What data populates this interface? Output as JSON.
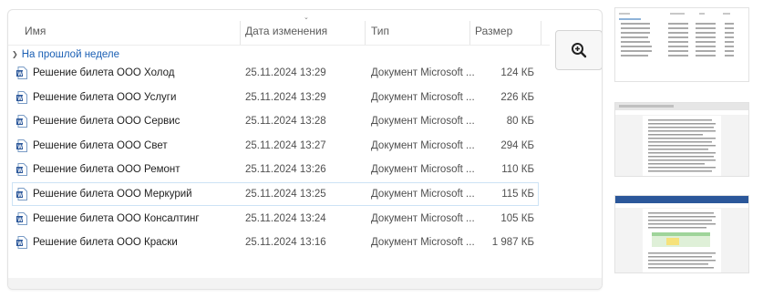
{
  "columns": {
    "name": "Имя",
    "date": "Дата изменения",
    "type": "Тип",
    "size": "Размер"
  },
  "group": {
    "label": "На прошлой неделе"
  },
  "files": [
    {
      "name": "Решение билета ООО Холод",
      "date": "25.11.2024 13:29",
      "type": "Документ Microsoft ...",
      "size": "124 КБ"
    },
    {
      "name": "Решение билета ООО Услуги",
      "date": "25.11.2024 13:29",
      "type": "Документ Microsoft ...",
      "size": "226 КБ"
    },
    {
      "name": "Решение билета ООО Сервис",
      "date": "25.11.2024 13:28",
      "type": "Документ Microsoft ...",
      "size": "80 КБ"
    },
    {
      "name": "Решение билета ООО Свет",
      "date": "25.11.2024 13:27",
      "type": "Документ Microsoft ...",
      "size": "294 КБ"
    },
    {
      "name": "Решение билета ООО Ремонт",
      "date": "25.11.2024 13:26",
      "type": "Документ Microsoft ...",
      "size": "110 КБ"
    },
    {
      "name": "Решение билета ООО Меркурий",
      "date": "25.11.2024 13:25",
      "type": "Документ Microsoft ...",
      "size": "115 КБ"
    },
    {
      "name": "Решение билета ООО Консалтинг",
      "date": "25.11.2024 13:24",
      "type": "Документ Microsoft ...",
      "size": "105 КБ"
    },
    {
      "name": "Решение билета ООО Краски",
      "date": "25.11.2024 13:16",
      "type": "Документ Microsoft ...",
      "size": "1 987 КБ"
    }
  ],
  "selected_file": "Решение билета ООО Меркурий",
  "icons": {
    "file": "word-document-icon",
    "preview": "zoom-in-icon",
    "group": "chevron-down-icon",
    "sort": "sort-caret-icon"
  },
  "colors": {
    "group_text": "#1a5fb4",
    "word_blue": "#2b579a",
    "selection_border": "#cde3f5"
  }
}
